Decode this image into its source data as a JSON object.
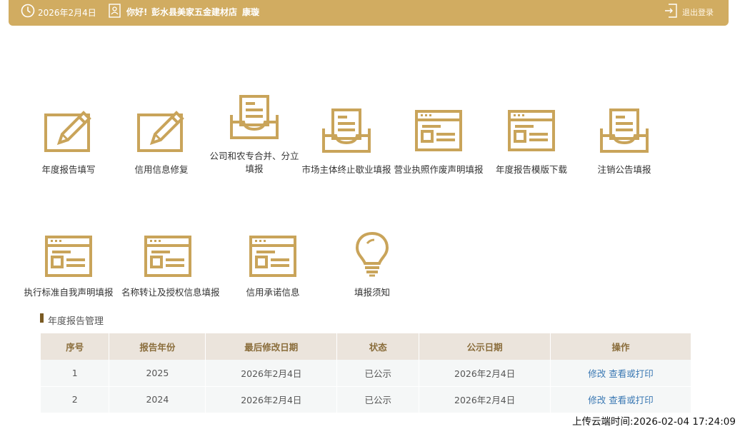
{
  "header": {
    "date": "2026年2月4日",
    "greeting": "你好!",
    "company": "彭水县美家五金建材店",
    "username": "康璇",
    "logout_label": "退出登录",
    "color": "#d1ac61"
  },
  "menu": {
    "items": [
      {
        "label": "年度报告填写",
        "icon": "edit-icon"
      },
      {
        "label": "信用信息修复",
        "icon": "edit-icon"
      },
      {
        "label": "公司和农专合并、分立填报",
        "icon": "inbox-icon"
      },
      {
        "label": "市场主体终止歇业填报",
        "icon": "inbox-icon"
      },
      {
        "label": "营业执照作废声明填报",
        "icon": "form-icon"
      },
      {
        "label": "年度报告模版下载",
        "icon": "form-icon"
      },
      {
        "label": "注销公告填报",
        "icon": "inbox-icon"
      },
      {
        "label": "执行标准自我声明填报",
        "icon": "form-icon"
      },
      {
        "label": "名称转让及授权信息填报",
        "icon": "form-icon"
      },
      {
        "label": "信用承诺信息",
        "icon": "form-icon"
      },
      {
        "label": "填报须知",
        "icon": "lightbulb-icon"
      }
    ],
    "icon_color": "#c9a45a"
  },
  "annual_reports": {
    "title": "年度报告管理",
    "columns": [
      "序号",
      "报告年份",
      "最后修改日期",
      "状态",
      "公示日期",
      "操作"
    ],
    "rows": [
      {
        "no": "1",
        "year": "2025",
        "modified": "2026年2月4日",
        "status": "已公示",
        "publish_date": "2026年2月4日",
        "edit": "修改",
        "view": "查看或打印"
      },
      {
        "no": "2",
        "year": "2024",
        "modified": "2026年2月4日",
        "status": "已公示",
        "publish_date": "2026年2月4日",
        "edit": "修改",
        "view": "查看或打印"
      }
    ]
  },
  "footer": {
    "upload_time": "上传云端时间:2026-02-04 17:24:09"
  }
}
